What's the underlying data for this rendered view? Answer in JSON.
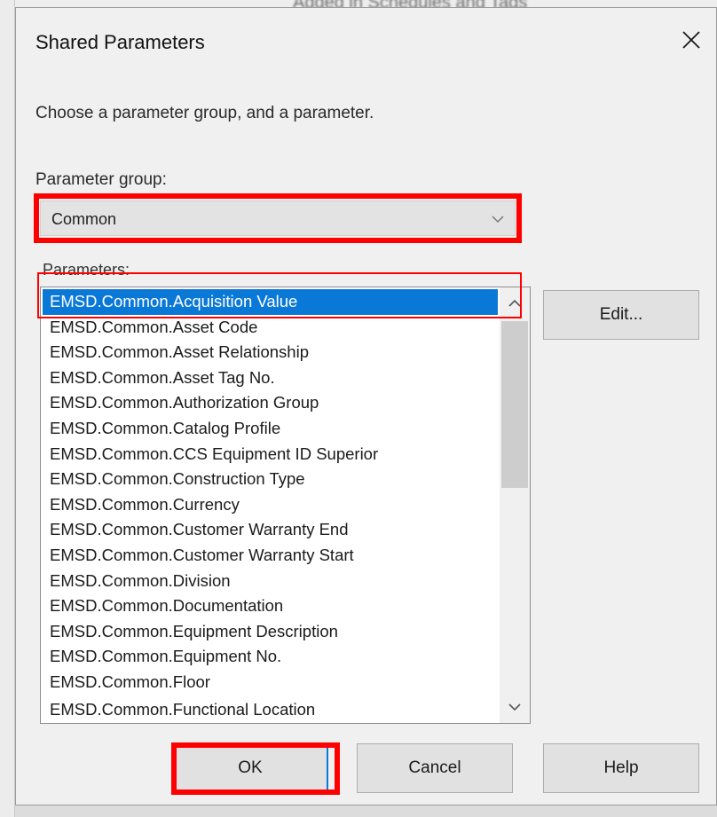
{
  "window": {
    "title": "Shared Parameters",
    "close_icon": "close-icon"
  },
  "background": {
    "partial_text": "Added in Schedules and Tags"
  },
  "instructions": "Choose a parameter group, and a parameter.",
  "parameter_group": {
    "label": "Parameter group:",
    "value": "Common",
    "icon": "chevron-down-icon"
  },
  "parameters": {
    "label": "Parameters:",
    "selected_index": 0,
    "items": [
      "EMSD.Common.Acquisition Value",
      "EMSD.Common.Asset Code",
      "EMSD.Common.Asset Relationship",
      "EMSD.Common.Asset Tag No.",
      "EMSD.Common.Authorization Group",
      "EMSD.Common.Catalog Profile",
      "EMSD.Common.CCS Equipment ID Superior",
      "EMSD.Common.Construction Type",
      "EMSD.Common.Currency",
      "EMSD.Common.Customer Warranty End",
      "EMSD.Common.Customer Warranty Start",
      "EMSD.Common.Division",
      "EMSD.Common.Documentation",
      "EMSD.Common.Equipment Description",
      "EMSD.Common.Equipment No.",
      "EMSD.Common.Floor",
      "EMSD.Common.Functional Location"
    ]
  },
  "buttons": {
    "edit": "Edit...",
    "ok": "OK",
    "cancel": "Cancel",
    "help": "Help"
  },
  "colors": {
    "highlight": "#ff0000",
    "selection": "#0a78d7",
    "dialog_bg": "#f0f0f0"
  }
}
